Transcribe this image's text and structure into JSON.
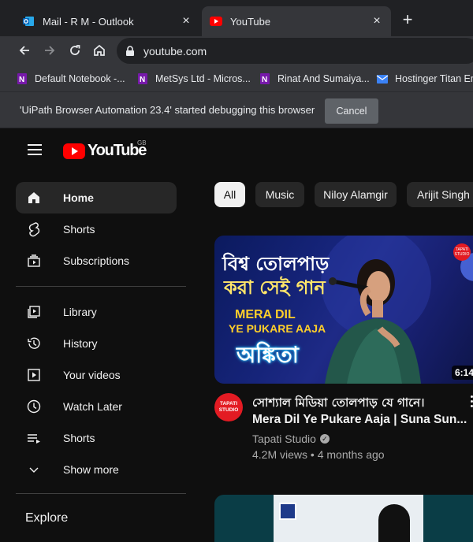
{
  "browser": {
    "tabs": [
      {
        "title": "Mail - R M - Outlook",
        "icon": "outlook-icon",
        "active": false
      },
      {
        "title": "YouTube",
        "icon": "youtube-icon",
        "active": true
      }
    ],
    "url": "youtube.com",
    "bookmarks": [
      {
        "label": "Default Notebook -...",
        "icon": "onenote-icon"
      },
      {
        "label": "MetSys Ltd - Micros...",
        "icon": "onenote-icon"
      },
      {
        "label": "Rinat And Sumaiya...",
        "icon": "onenote-icon"
      },
      {
        "label": "Hostinger Titan Em",
        "icon": "mail-icon"
      }
    ],
    "debug_message": "'UiPath Browser Automation 23.4' started debugging this browser",
    "cancel_label": "Cancel"
  },
  "youtube": {
    "logo_text": "YouTube",
    "country_code": "GB",
    "sidebar": {
      "items": [
        {
          "label": "Home",
          "icon": "home-icon"
        },
        {
          "label": "Shorts",
          "icon": "shorts-icon"
        },
        {
          "label": "Subscriptions",
          "icon": "subscriptions-icon"
        },
        {
          "label": "Library",
          "icon": "library-icon"
        },
        {
          "label": "History",
          "icon": "history-icon"
        },
        {
          "label": "Your videos",
          "icon": "your-videos-icon"
        },
        {
          "label": "Watch Later",
          "icon": "watch-later-icon"
        },
        {
          "label": "Shorts",
          "icon": "playlist-icon"
        },
        {
          "label": "Show more",
          "icon": "chevron-down-icon"
        }
      ],
      "explore_heading": "Explore"
    },
    "chips": [
      "All",
      "Music",
      "Niloy Alamgir",
      "Arijit Singh"
    ],
    "video": {
      "duration": "6:14",
      "thumbnail_text": {
        "line1": "বিশ্ব তোলপাড়",
        "line2": "করা সেই গান",
        "line3": "MERA DIL",
        "line4": "YE PUKARE AAJA",
        "line5": "অঙ্কিতা",
        "badge": "TAPATI STUDIO"
      },
      "avatar_text": "TAPATI STUDIO",
      "title_line1": "সোশ্যাল মিডিয়া তোলপাড় যে গানে।",
      "title_line2": "Mera Dil Ye Pukare Aaja | Suna Sun...",
      "channel": "Tapati Studio",
      "views": "4.2M views",
      "age": "4 months ago"
    }
  }
}
